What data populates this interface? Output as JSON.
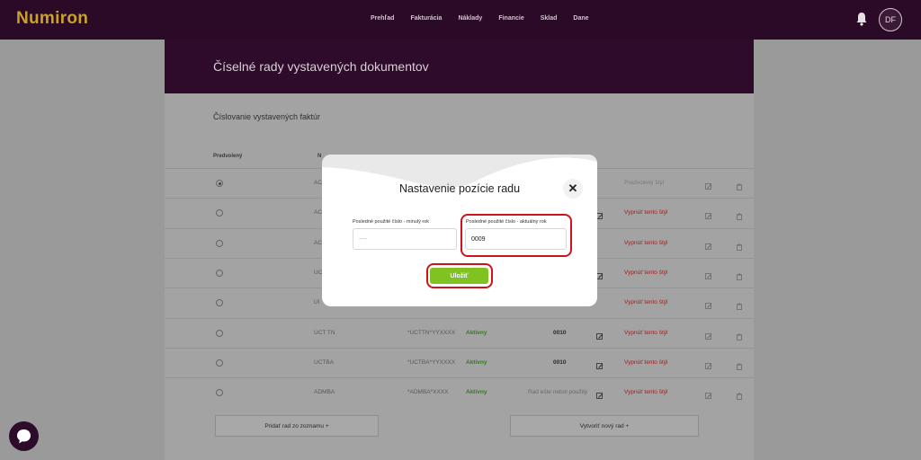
{
  "app": {
    "logo": "Numiron",
    "avatar_initials": "DF"
  },
  "nav": [
    "Prehľad",
    "Fakturácia",
    "Náklady",
    "Financie",
    "Sklad",
    "Dane"
  ],
  "page": {
    "title": "Číselné rady vystavených dokumentov",
    "section_title": "Číslovanie vystavených faktúr",
    "col_default": "Predvolený",
    "col_name_partial": "N"
  },
  "rows": [
    {
      "selected": true,
      "name": "AC",
      "format": "",
      "status": "",
      "number": "",
      "action": "Predvolený štýl",
      "action_muted": true
    },
    {
      "selected": false,
      "name": "AC",
      "format": "",
      "status": "",
      "number": "",
      "action": "Vypnúť tento štýl",
      "action_muted": false
    },
    {
      "selected": false,
      "name": "AC",
      "format": "",
      "status": "",
      "number": "",
      "action": "Vypnúť tento štýl",
      "action_muted": false
    },
    {
      "selected": false,
      "name": "UC",
      "format": "",
      "status": "",
      "number": "",
      "action": "Vypnúť tento štýl",
      "action_muted": false
    },
    {
      "selected": false,
      "name": "UI",
      "format": "",
      "status": "",
      "number": "",
      "action": "Vypnúť tento štýl",
      "action_muted": false
    },
    {
      "selected": false,
      "name": "UCT TN",
      "format": "*UCTTN*YYXXXX",
      "status": "Aktívny",
      "number": "0010",
      "action": "Vypnúť tento štýl",
      "action_muted": false
    },
    {
      "selected": false,
      "name": "UCTBA",
      "format": "*UCTBA*YYXXXX",
      "status": "Aktívny",
      "number": "0010",
      "action": "Vypnúť tento štýl",
      "action_muted": false
    },
    {
      "selected": false,
      "name": "ADMBA",
      "format": "*ADMBA*XXXX",
      "status": "Aktívny",
      "number": "Rad ešte nebol použitý",
      "action": "Vypnúť tento štýl",
      "action_muted": false
    }
  ],
  "buttons": {
    "add_from_list": "Pridať rad zo zoznamu  +",
    "create_new": "Vytvoriť nový rad  +"
  },
  "modal": {
    "title": "Nastavenie pozície radu",
    "close": "✕",
    "prev_year_label": "Posledné použité číslo - minulý rok",
    "prev_year_value": "----",
    "curr_year_label": "Posledné použité číslo - aktuálny rok",
    "curr_year_value": "0009",
    "save": "Uložiť"
  },
  "colors": {
    "topbar": "#2a0a26",
    "logo": "#c9a227",
    "save": "#7fc222",
    "highlight": "#d0121c",
    "active": "#2f7d1c",
    "danger": "#a81c1c"
  }
}
